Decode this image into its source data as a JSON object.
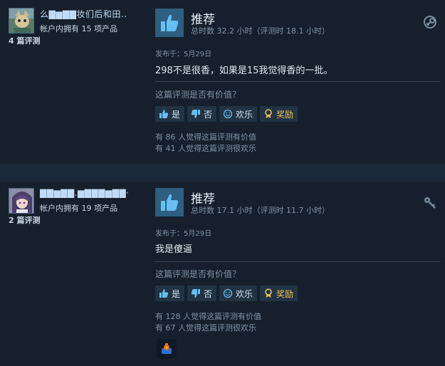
{
  "reviews": [
    {
      "username": "么▇▆▇▇妆们后和田..",
      "products_owned": "帐户内拥有 15 项产品",
      "review_count": "4 篇评测",
      "verdict": "推荐",
      "hours": "总时数 32.2 小时（评测时 18.1 小时）",
      "posted": "发布于：5月29日",
      "content": "298不是很香，如果是15我觉得香的一批。",
      "helpful_question": "这篇评测是否有价值？",
      "buttons": {
        "yes": "是",
        "no": "否",
        "funny": "欢乐",
        "award": "奖励"
      },
      "helpful_stat": "有 86 人觉得这篇评测有价值",
      "funny_stat": "有 41 人觉得这篇评测很欢乐",
      "corner_icon": "steam-icon"
    },
    {
      "username": "▇▇▆▇▇.▆▇▇▇▆▇▇·",
      "products_owned": "帐户内拥有 19 项产品",
      "review_count": "2 篇评测",
      "verdict": "推荐",
      "hours": "总时数 17.1 小时（评测时 11.7 小时）",
      "posted": "发布于：5月29日",
      "content": "我是傻逼",
      "helpful_question": "这篇评测是否有价值？",
      "buttons": {
        "yes": "是",
        "no": "否",
        "funny": "欢乐",
        "award": "奖励"
      },
      "helpful_stat": "有 128 人觉得这篇评测有价值",
      "funny_stat": "有 67 人觉得这篇评测很欢乐",
      "corner_icon": "key-icon",
      "award_badge": "award-badge-icon"
    }
  ],
  "colors": {
    "page_bg": "#1b2838",
    "card_bg": "#16202d",
    "thumb_box": "#2e5e80",
    "accent_blue": "#66c0f4",
    "award_gold": "#e8c15a"
  }
}
